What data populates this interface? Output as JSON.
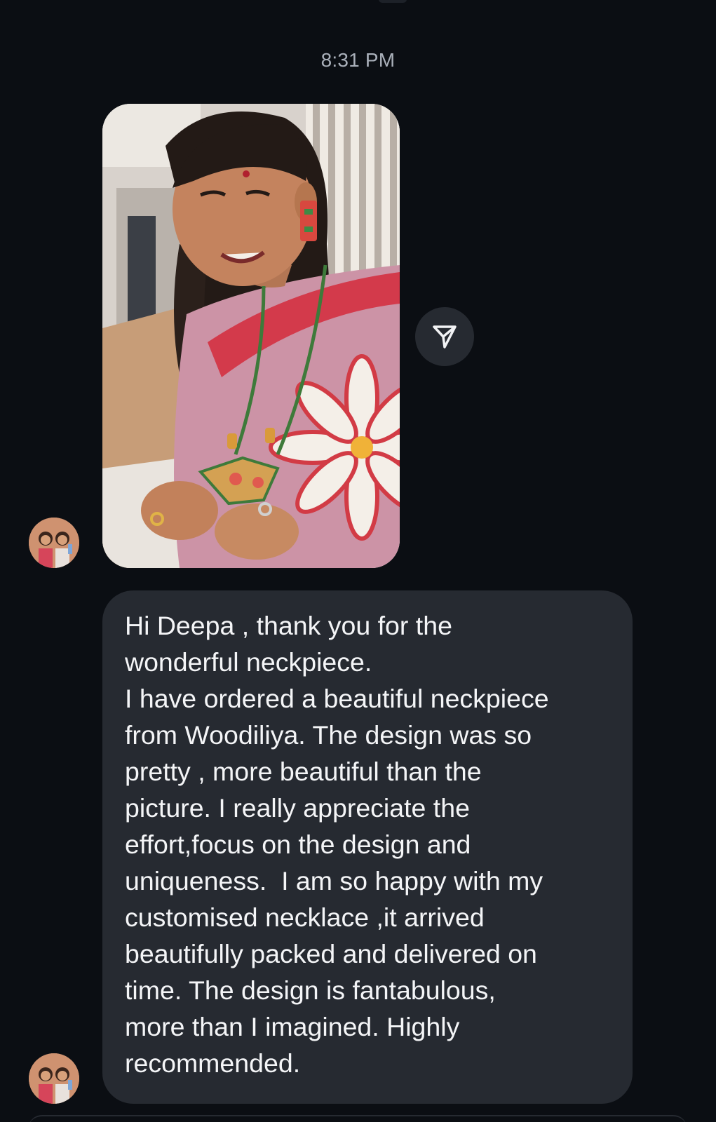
{
  "thread": {
    "timestamp": "8:31 PM",
    "photo_message": {
      "image_icon": "photo-of-woman-wearing-pendant-necklace"
    },
    "share_icon": "paper-plane-icon",
    "text_message": {
      "text": "Hi Deepa , thank you for the\nwonderful neckpiece.\nI have ordered a beautiful neckpiece\nfrom Woodiliya. The design was so\npretty , more beautiful than the\npicture. I really appreciate the\neffort,focus on the design and\nuniqueness.  I am so happy with my\ncustomised necklace ,it arrived\nbeautifully packed and delivered on\ntime. The design is fantabulous,\nmore than I imagined. Highly\nrecommended."
    }
  },
  "colors": {
    "background": "#0b0e13",
    "bubble": "#262a31",
    "timestamp_text": "#aab0ba",
    "message_text": "#f4f5f7"
  }
}
